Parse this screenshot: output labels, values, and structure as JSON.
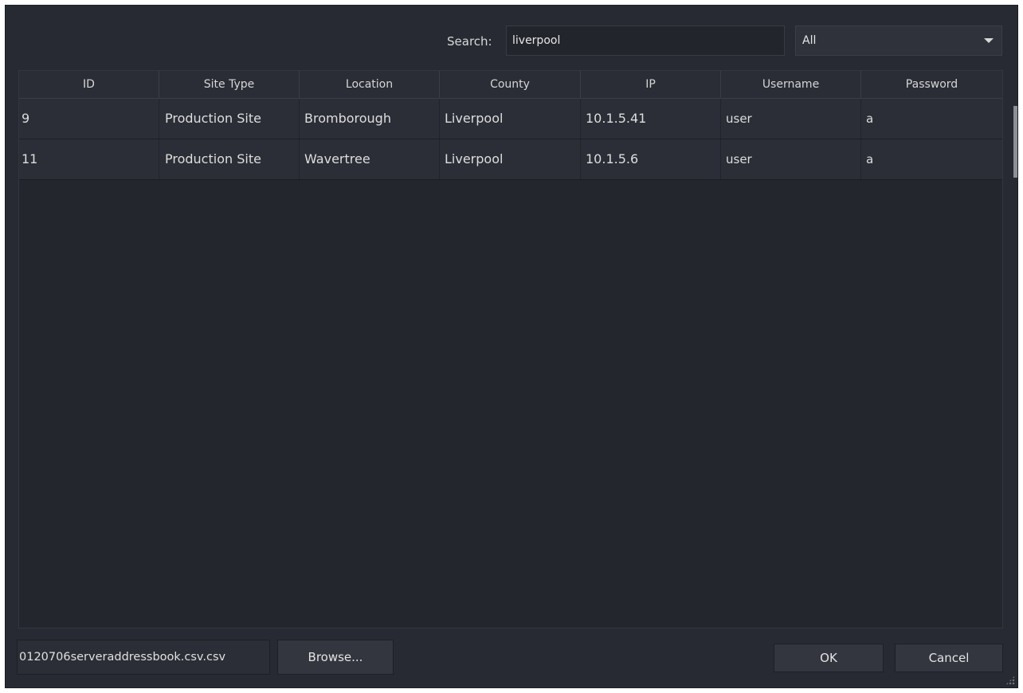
{
  "search": {
    "label": "Search:",
    "value": "liverpool"
  },
  "filter": {
    "selected": "All"
  },
  "table": {
    "columns": [
      "ID",
      "Site Type",
      "Location",
      "County",
      "IP",
      "Username",
      "Password"
    ],
    "rows": [
      [
        "9",
        "Production Site",
        "Bromborough",
        "Liverpool",
        "10.1.5.41",
        "user",
        "a"
      ],
      [
        "11",
        "Production Site",
        "Wavertree",
        "Liverpool",
        "10.1.5.6",
        "user",
        "a"
      ]
    ]
  },
  "footer": {
    "file_path": "0120706serveraddressbook.csv.csv",
    "browse_label": "Browse...",
    "ok_label": "OK",
    "cancel_label": "Cancel"
  }
}
